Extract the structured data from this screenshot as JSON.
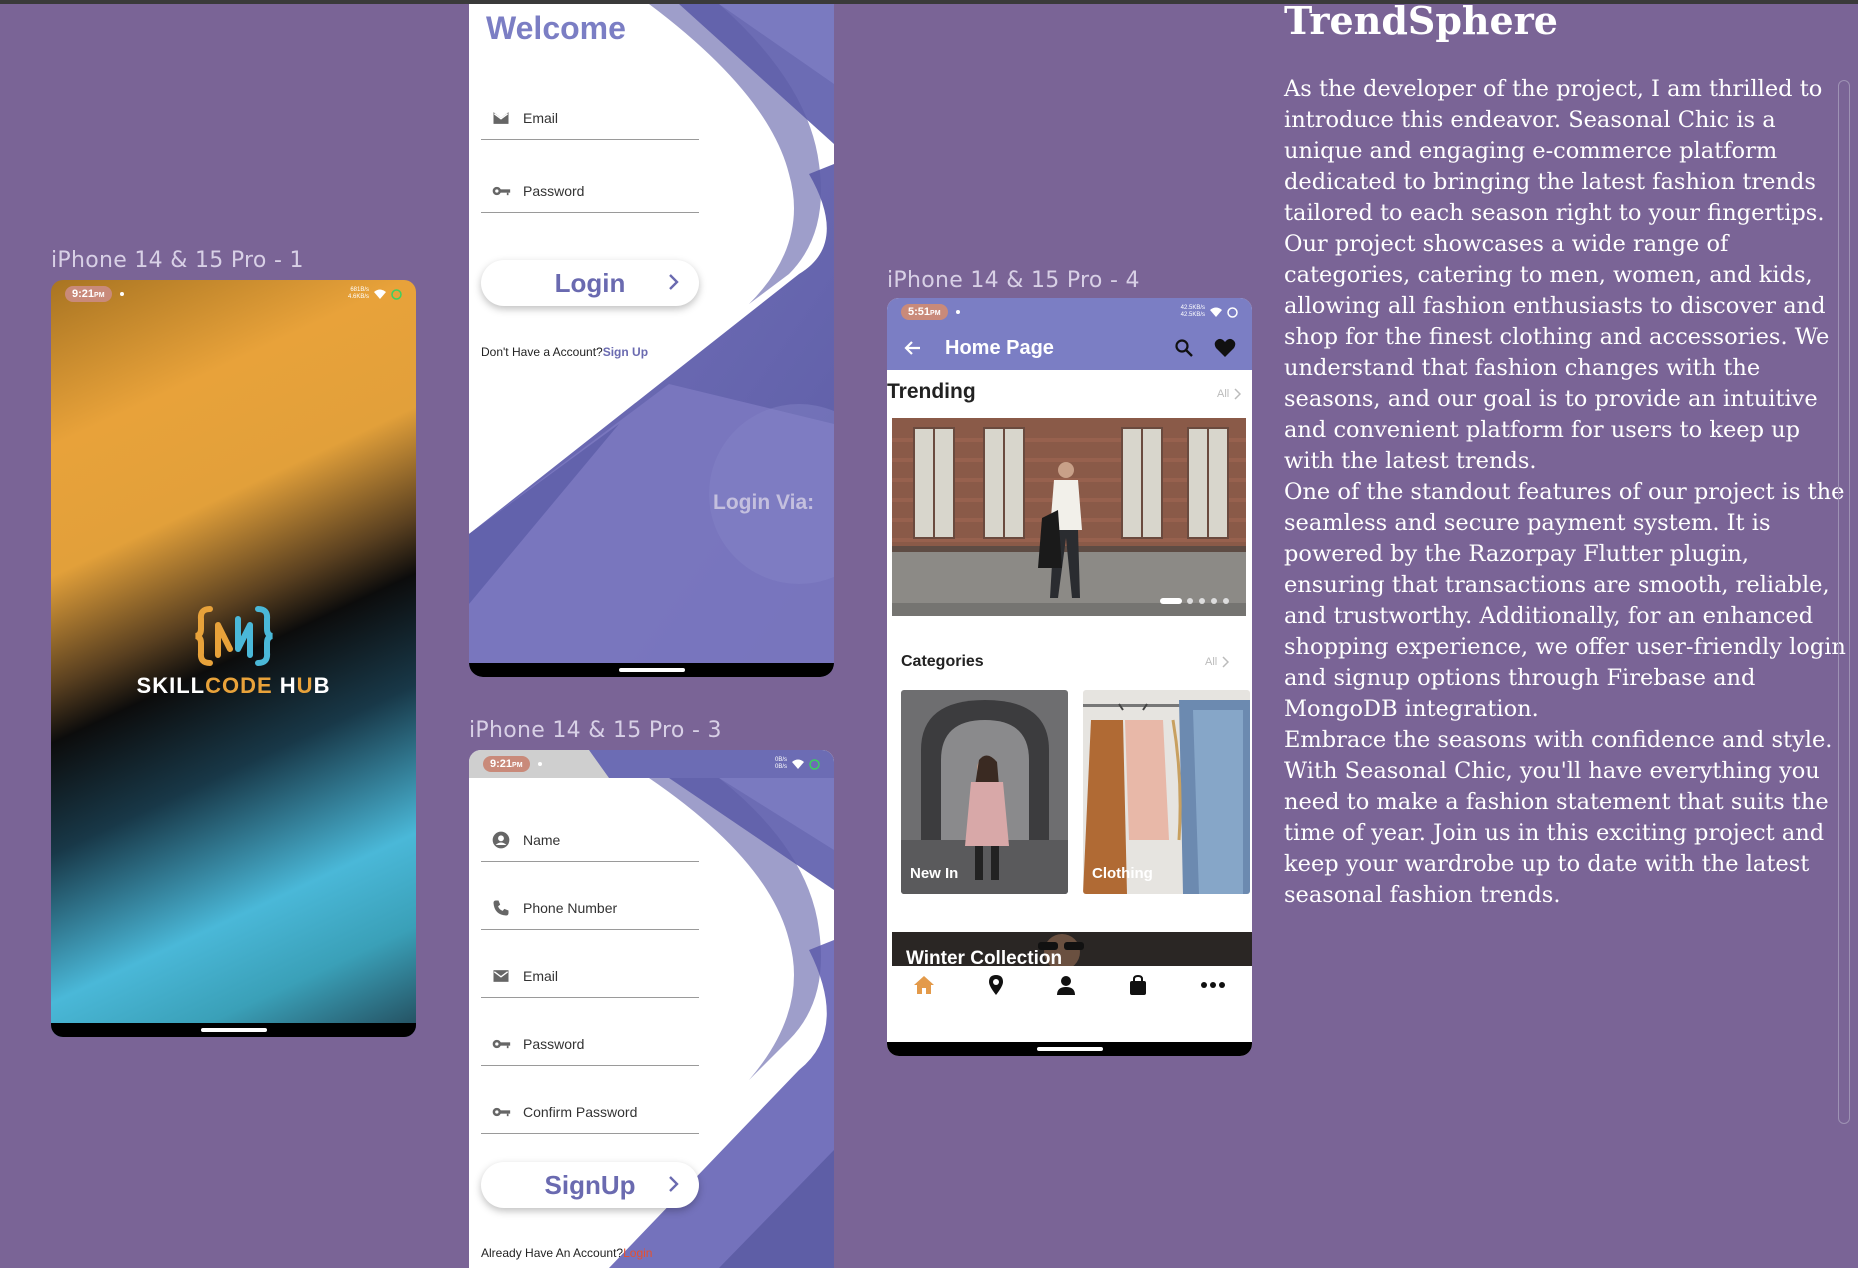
{
  "frames": {
    "frame1_label": "iPhone 14 & 15 Pro - 1",
    "frame3_label": "iPhone 14 & 15 Pro - 3",
    "frame4_label": "iPhone 14 & 15 Pro - 4"
  },
  "splash": {
    "time": "9:21",
    "ampm": "PM",
    "net_up": "681B/s",
    "net_down": "4.6KB/s",
    "brand_part1": "SKILL",
    "brand_part2": "CODE",
    "brand_part3": " H",
    "brand_part4": "U",
    "brand_part5": "B"
  },
  "login": {
    "title": "Welcome",
    "email_placeholder": "Email",
    "password_placeholder": "Password",
    "login_button": "Login",
    "no_account_text": "Don't Have a Account?",
    "signup_link": "Sign Up",
    "login_via": "Login  Via:"
  },
  "signup": {
    "time": "9:21",
    "ampm": "PM",
    "net_up": "0B/s",
    "net_down": "0B/s",
    "name_placeholder": "Name",
    "phone_placeholder": "Phone Number",
    "email_placeholder": "Email",
    "password_placeholder": "Password",
    "confirm_placeholder": "Confirm Password",
    "signup_button": "SignUp",
    "have_account_text": "Already Have An Account?",
    "login_link": "Login"
  },
  "home": {
    "time": "5:51",
    "ampm": "PM",
    "net_up": "42.5KB/s",
    "net_down": "42.5KB/s",
    "title": "Home Page",
    "trending": "Trending",
    "all_label": "All",
    "categories": "Categories",
    "cat_new_in": "New In",
    "cat_clothing": "Clothing",
    "winter": "Winter Collection",
    "carousel_active_index": 0
  },
  "article": {
    "title": "TrendSphere",
    "p1": "As the developer of the project,  I am thrilled to introduce this endeavor. Seasonal Chic is a unique and engaging e-commerce platform dedicated to bringing the latest fashion trends tailored to each season right to your fingertips.",
    "p2": "Our project showcases a wide range of categories, catering to men, women, and kids, allowing all fashion enthusiasts to discover and shop for the finest clothing and accessories. We understand that fashion changes with the seasons, and our goal is to provide an intuitive and convenient platform for users to keep up with the latest trends.",
    "p3": "One of the standout features of our project is the seamless and secure payment system. It is powered by the Razorpay Flutter plugin, ensuring that transactions are smooth, reliable, and trustworthy. Additionally, for an enhanced shopping experience, we offer user-friendly login and signup options through Firebase and MongoDB integration.",
    "p4": "Embrace the seasons with confidence and style. With Seasonal Chic, you'll have everything you need to make a fashion statement that suits the time of year. Join us in this exciting project and keep your wardrobe up to date with the latest seasonal fashion trends."
  },
  "colors": {
    "background": "#7a6496",
    "accent_purple": "#7b7ec4",
    "brand_orange": "#e8a23a",
    "brand_teal": "#4ab8d8",
    "home_icon": "#e39a4a",
    "link_red": "#e8502e"
  }
}
